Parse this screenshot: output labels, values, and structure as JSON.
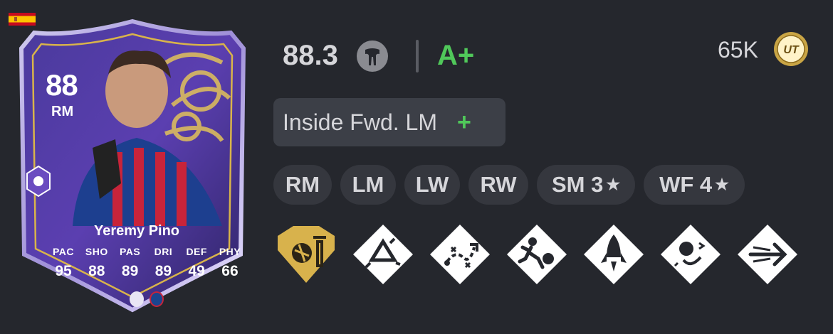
{
  "card": {
    "rating": "88",
    "position": "RM",
    "name": "Yeremy Pino",
    "stats": [
      {
        "label": "PAC",
        "value": "95"
      },
      {
        "label": "SHO",
        "value": "88"
      },
      {
        "label": "PAS",
        "value": "89"
      },
      {
        "label": "DRI",
        "value": "89"
      },
      {
        "label": "DEF",
        "value": "49"
      },
      {
        "label": "PHY",
        "value": "66"
      }
    ],
    "nation_icon": "spain-flag-icon",
    "league_icon": "premier-league-icon",
    "club_icon": "crystal-palace-icon"
  },
  "summary": {
    "score": "88.3",
    "score_icon": "body-type-icon",
    "grade": "A+",
    "grade_color": "#50c85a",
    "price": "65K",
    "coin_icon": "ut-coin-icon",
    "coin_label": "UT"
  },
  "role": {
    "label": "Inside Fwd. LM",
    "plus": "+"
  },
  "positions": [
    {
      "label": "RM"
    },
    {
      "label": "LM"
    },
    {
      "label": "LW"
    },
    {
      "label": "RW"
    },
    {
      "label": "SM 3",
      "star": "★"
    },
    {
      "label": "WF 4",
      "star": "★"
    }
  ],
  "playstyles": [
    {
      "icon": "gold-playstyle-plus-icon",
      "plus": true
    },
    {
      "icon": "rebound-playstyle-icon"
    },
    {
      "icon": "tiki-taka-playstyle-icon"
    },
    {
      "icon": "first-touch-playstyle-icon"
    },
    {
      "icon": "rapid-playstyle-icon"
    },
    {
      "icon": "technical-playstyle-icon"
    },
    {
      "icon": "quick-step-playstyle-icon"
    }
  ]
}
